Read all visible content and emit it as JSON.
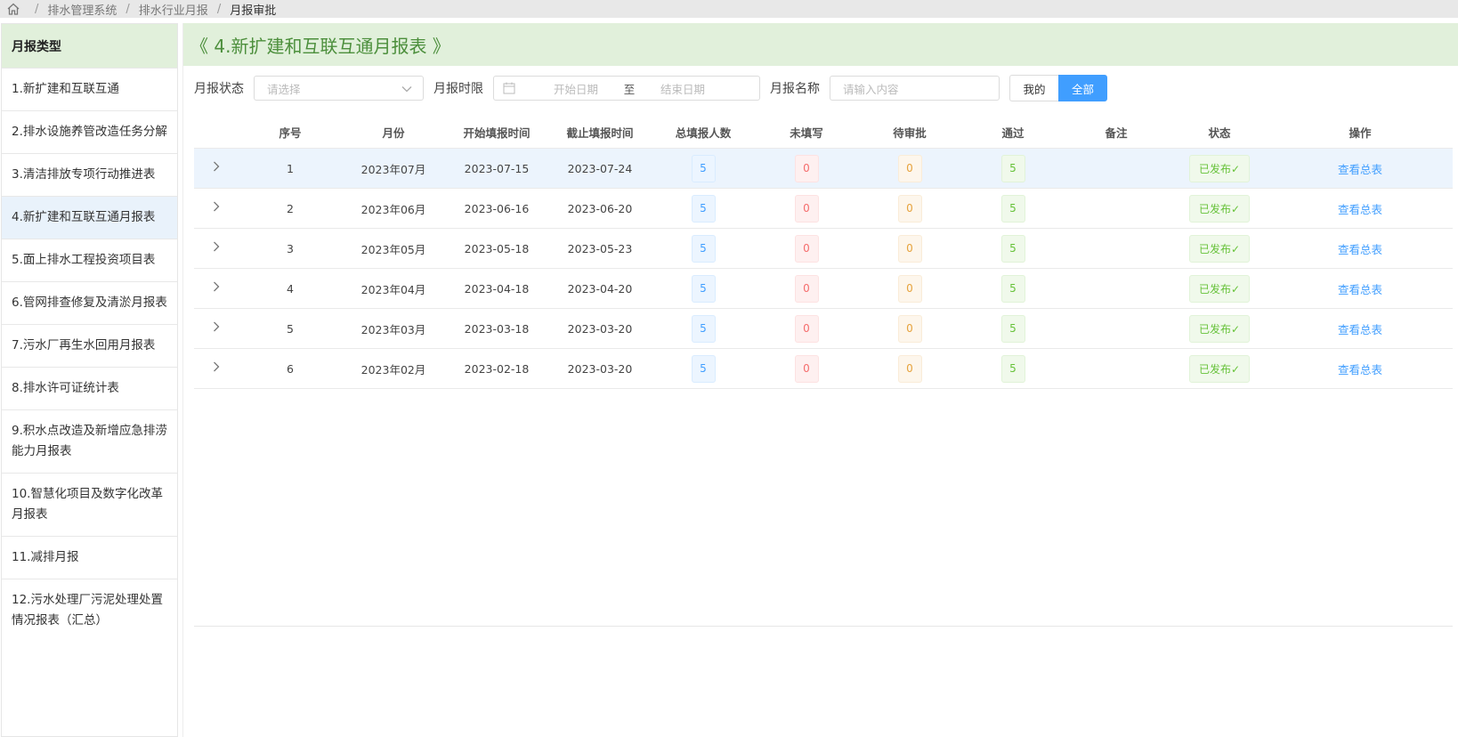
{
  "breadcrumb": {
    "items": [
      "排水管理系统",
      "排水行业月报",
      "月报审批"
    ]
  },
  "sidebar": {
    "title": "月报类型",
    "items": [
      "1.新扩建和互联互通",
      "2.排水设施养管改造任务分解",
      "3.清洁排放专项行动推进表",
      "4.新扩建和互联互通月报表",
      "5.面上排水工程投资项目表",
      "6.管网排查修复及清淤月报表",
      "7.污水厂再生水回用月报表",
      "8.排水许可证统计表",
      "9.积水点改造及新增应急排涝能力月报表",
      "10.智慧化项目及数字化改革月报表",
      "11.减排月报",
      "12.污水处理厂污泥处理处置情况报表（汇总）"
    ],
    "active_index": 3
  },
  "main": {
    "title": "《 4.新扩建和互联互通月报表 》",
    "filters": {
      "status_label": "月报状态",
      "status_placeholder": "请选择",
      "period_label": "月报时限",
      "start_placeholder": "开始日期",
      "range_sep": "至",
      "end_placeholder": "结束日期",
      "name_label": "月报名称",
      "name_placeholder": "请输入内容",
      "mine_label": "我的",
      "all_label": "全部"
    },
    "table": {
      "headers": [
        "",
        "序号",
        "月份",
        "开始填报时间",
        "截止填报时间",
        "总填报人数",
        "未填写",
        "待审批",
        "通过",
        "备注",
        "状态",
        "操作"
      ],
      "rows": [
        {
          "no": "1",
          "month": "2023年07月",
          "start": "2023-07-15",
          "end": "2023-07-24",
          "total": "5",
          "unfilled": "0",
          "pending": "0",
          "passed": "5",
          "remark": "",
          "status": "已发布✓",
          "action": "查看总表"
        },
        {
          "no": "2",
          "month": "2023年06月",
          "start": "2023-06-16",
          "end": "2023-06-20",
          "total": "5",
          "unfilled": "0",
          "pending": "0",
          "passed": "5",
          "remark": "",
          "status": "已发布✓",
          "action": "查看总表"
        },
        {
          "no": "3",
          "month": "2023年05月",
          "start": "2023-05-18",
          "end": "2023-05-23",
          "total": "5",
          "unfilled": "0",
          "pending": "0",
          "passed": "5",
          "remark": "",
          "status": "已发布✓",
          "action": "查看总表"
        },
        {
          "no": "4",
          "month": "2023年04月",
          "start": "2023-04-18",
          "end": "2023-04-20",
          "total": "5",
          "unfilled": "0",
          "pending": "0",
          "passed": "5",
          "remark": "",
          "status": "已发布✓",
          "action": "查看总表"
        },
        {
          "no": "5",
          "month": "2023年03月",
          "start": "2023-03-18",
          "end": "2023-03-20",
          "total": "5",
          "unfilled": "0",
          "pending": "0",
          "passed": "5",
          "remark": "",
          "status": "已发布✓",
          "action": "查看总表"
        },
        {
          "no": "6",
          "month": "2023年02月",
          "start": "2023-02-18",
          "end": "2023-03-20",
          "total": "5",
          "unfilled": "0",
          "pending": "0",
          "passed": "5",
          "remark": "",
          "status": "已发布✓",
          "action": "查看总表"
        }
      ]
    }
  },
  "colors": {
    "accent": "#409eff",
    "header_green": "#e1f0db",
    "title_green": "#4c8f3c"
  }
}
